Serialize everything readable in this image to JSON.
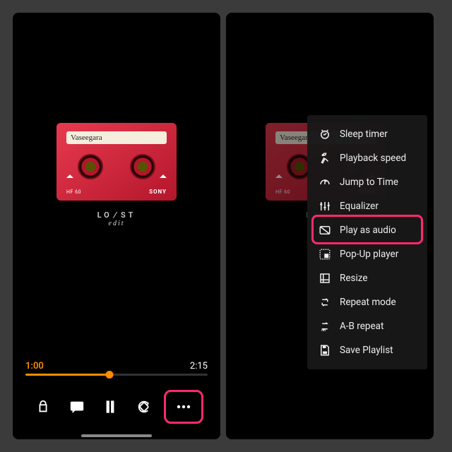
{
  "album": {
    "track_label": "Vaseegara",
    "tape_model": "HF 60",
    "tape_brand": "SONY",
    "artist_line1_a": "LO",
    "artist_line1_b": "ST",
    "artist_line2": "edit"
  },
  "player": {
    "current_time": "1:00",
    "total_time": "2:15",
    "progress_pct": 46
  },
  "menu": {
    "items": [
      {
        "icon": "sleep",
        "label": "Sleep timer"
      },
      {
        "icon": "speed",
        "label": "Playback speed"
      },
      {
        "icon": "jump",
        "label": "Jump to Time"
      },
      {
        "icon": "eq",
        "label": "Equalizer"
      },
      {
        "icon": "audio",
        "label": "Play as audio"
      },
      {
        "icon": "popup",
        "label": "Pop-Up player"
      },
      {
        "icon": "resize",
        "label": "Resize"
      },
      {
        "icon": "repeat",
        "label": "Repeat mode"
      },
      {
        "icon": "abrepeat",
        "label": "A-B repeat"
      },
      {
        "icon": "save",
        "label": "Save Playlist"
      }
    ],
    "highlighted_index": 4
  },
  "colors": {
    "accent": "#ff8c00",
    "highlight": "#ff2a6d"
  }
}
